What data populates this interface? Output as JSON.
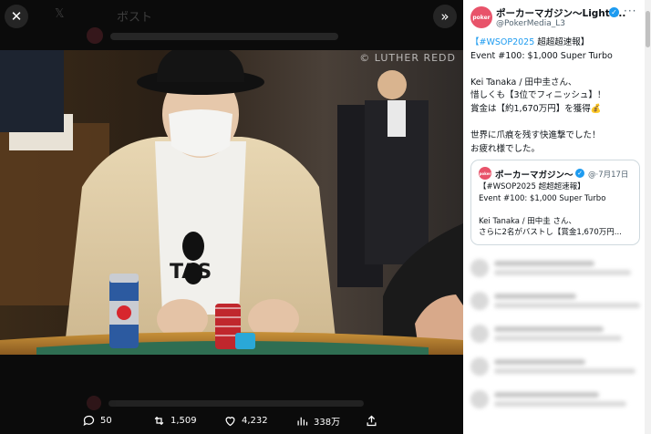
{
  "viewer": {
    "close_icon": "close-icon",
    "expand_icon": "chevrons-right-icon",
    "ghost_header": "ポスト",
    "watermark": "© LUTHER REDD",
    "actions": {
      "replies": "50",
      "reposts": "1,509",
      "likes": "4,232",
      "views": "338万"
    }
  },
  "post": {
    "author_name": "ポーカーマガジン～LightT...",
    "handle": "@PokerMedia_L3",
    "more": "···",
    "lines": [
      {
        "hashtag": "【#WSOP2025",
        "rest": " 超超超速報】"
      },
      {
        "text": "Event #100: $1,000 Super Turbo"
      },
      {
        "text": ""
      },
      {
        "text": "Kei Tanaka / 田中圭さん、"
      },
      {
        "text": "惜しくも【3位でフィニッシュ】！"
      },
      {
        "text": "賞金は【約1,670万円】を獲得💰"
      },
      {
        "text": ""
      },
      {
        "text": "世界に爪痕を残す快進撃でした！"
      },
      {
        "text": "お疲れ様でした。"
      }
    ]
  },
  "quote": {
    "author_name": "ポーカーマガジン～",
    "meta": "@·7月17日",
    "lines": [
      "【#WSOP2025 超超超速報】",
      "Event #100: $1,000 Super Turbo",
      "",
      "Kei Tanaka / 田中圭 さん、",
      "さらに2名がバストし【賞金1,670万円..."
    ]
  },
  "colors": {
    "accent": "#1d9bf0",
    "avatar": "#e8536a",
    "viewer_bg": "#0b0b0b"
  }
}
